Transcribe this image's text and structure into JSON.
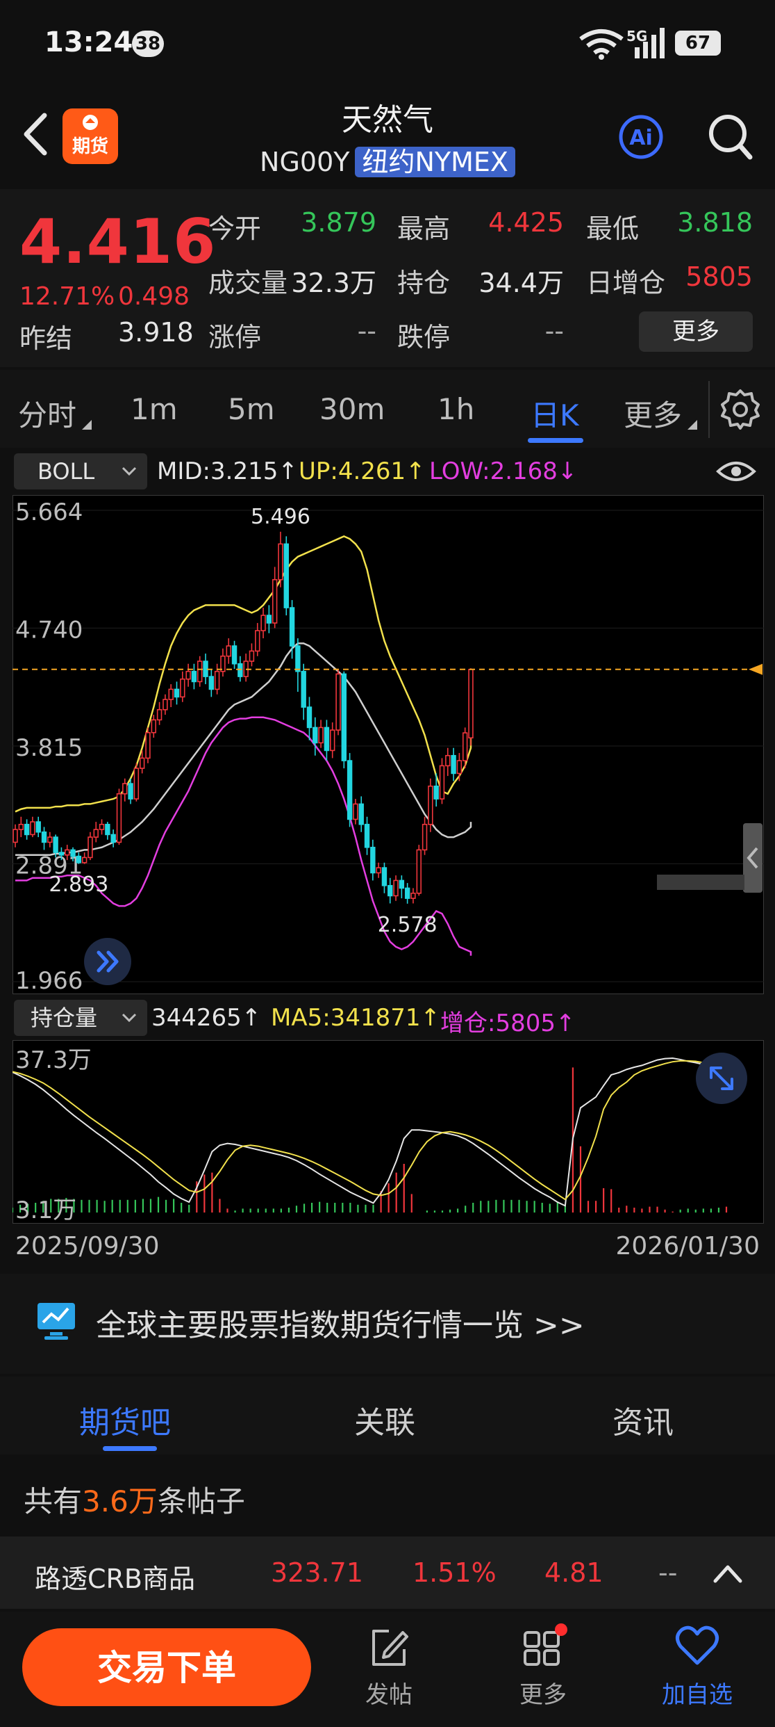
{
  "status_bar": {
    "time": "13:24",
    "notif_count": "38",
    "signal": "5G",
    "battery": "67"
  },
  "header": {
    "title": "天然气",
    "code": "NG00Y",
    "exchange": "纽约NYMEX",
    "logo_text": "期货",
    "ai_label": "Ai"
  },
  "quote": {
    "last": "4.416",
    "change_pct": "12.71%",
    "change": "0.498",
    "prev_label": "昨结",
    "prev": "3.918",
    "rows": [
      [
        {
          "label": "今开",
          "value": "3.879",
          "tone": "green"
        },
        {
          "label": "最高",
          "value": "4.425",
          "tone": "red"
        },
        {
          "label": "最低",
          "value": "3.818",
          "tone": "green"
        }
      ],
      [
        {
          "label": "成交量",
          "value": "32.3万",
          "tone": "white"
        },
        {
          "label": "持仓",
          "value": "34.4万",
          "tone": "white"
        },
        {
          "label": "日增仓",
          "value": "5805",
          "tone": "red"
        }
      ],
      [
        {
          "label": "涨停",
          "value": "--",
          "tone": "muted"
        },
        {
          "label": "跌停",
          "value": "--",
          "tone": "muted"
        }
      ]
    ],
    "more_label": "更多"
  },
  "period_tabs": [
    "分时",
    "1m",
    "5m",
    "30m",
    "1h",
    "日K",
    "更多"
  ],
  "period_active": "日K",
  "boll": {
    "selector": "BOLL",
    "mid": "MID:3.215↑",
    "up": "UP:4.261↑",
    "low": "LOW:2.168↓"
  },
  "position": {
    "selector": "持仓量",
    "value": "344265↑",
    "ma5": "MA5:341871↑",
    "inc": "增仓:5805↑"
  },
  "chart_data": [
    {
      "type": "candlestick",
      "title": "",
      "y_ticks": [
        "5.664",
        "4.740",
        "3.815",
        "2.891",
        "1.966"
      ],
      "ylim": [
        1.966,
        5.664
      ],
      "current_price": 4.416,
      "annotations": [
        {
          "label": "5.496",
          "value": 5.496
        },
        {
          "label": "2.893",
          "value": 2.893
        },
        {
          "label": "2.578",
          "value": 2.578
        }
      ],
      "candles": [
        [
          3.06,
          3.16,
          3.02,
          3.2
        ],
        [
          3.16,
          3.2,
          3.1,
          3.26
        ],
        [
          3.2,
          3.12,
          3.08,
          3.24
        ],
        [
          3.12,
          3.22,
          3.1,
          3.26
        ],
        [
          3.22,
          3.14,
          3.1,
          3.26
        ],
        [
          3.14,
          3.06,
          3.0,
          3.18
        ],
        [
          3.06,
          3.1,
          3.02,
          3.14
        ],
        [
          3.1,
          2.98,
          2.94,
          3.12
        ],
        [
          2.98,
          2.96,
          2.92,
          3.02
        ],
        [
          2.96,
          3.0,
          2.92,
          3.04
        ],
        [
          3.0,
          2.95,
          2.91,
          3.02
        ],
        [
          2.95,
          2.9,
          2.89,
          2.98
        ],
        [
          2.9,
          2.94,
          2.89,
          2.98
        ],
        [
          2.94,
          3.1,
          2.92,
          3.14
        ],
        [
          3.1,
          3.16,
          3.06,
          3.22
        ],
        [
          3.16,
          3.2,
          3.12,
          3.24
        ],
        [
          3.2,
          3.12,
          3.08,
          3.22
        ],
        [
          3.12,
          3.06,
          3.02,
          3.16
        ],
        [
          3.06,
          3.44,
          3.04,
          3.48
        ],
        [
          3.44,
          3.52,
          3.38,
          3.56
        ],
        [
          3.52,
          3.4,
          3.36,
          3.56
        ],
        [
          3.4,
          3.64,
          3.38,
          3.68
        ],
        [
          3.64,
          3.72,
          3.6,
          3.78
        ],
        [
          3.72,
          3.92,
          3.68,
          3.96
        ],
        [
          3.92,
          4.02,
          3.88,
          4.06
        ],
        [
          4.02,
          4.1,
          3.98,
          4.16
        ],
        [
          4.1,
          4.18,
          4.06,
          4.22
        ],
        [
          4.18,
          4.26,
          4.12,
          4.3
        ],
        [
          4.26,
          4.2,
          4.14,
          4.32
        ],
        [
          4.2,
          4.34,
          4.16,
          4.4
        ],
        [
          4.34,
          4.4,
          4.28,
          4.46
        ],
        [
          4.4,
          4.32,
          4.26,
          4.46
        ],
        [
          4.32,
          4.48,
          4.28,
          4.52
        ],
        [
          4.48,
          4.36,
          4.3,
          4.54
        ],
        [
          4.36,
          4.26,
          4.2,
          4.42
        ],
        [
          4.26,
          4.4,
          4.22,
          4.46
        ],
        [
          4.4,
          4.52,
          4.36,
          4.58
        ],
        [
          4.52,
          4.6,
          4.46,
          4.66
        ],
        [
          4.6,
          4.46,
          4.42,
          4.64
        ],
        [
          4.46,
          4.36,
          4.32,
          4.52
        ],
        [
          4.36,
          4.48,
          4.32,
          4.54
        ],
        [
          4.48,
          4.56,
          4.44,
          4.62
        ],
        [
          4.56,
          4.72,
          4.52,
          4.78
        ],
        [
          4.72,
          4.84,
          4.66,
          4.9
        ],
        [
          4.84,
          4.78,
          4.7,
          4.92
        ],
        [
          4.78,
          5.12,
          4.74,
          5.22
        ],
        [
          5.12,
          5.4,
          5.06,
          5.496
        ],
        [
          5.4,
          4.9,
          4.84,
          5.46
        ],
        [
          4.9,
          4.6,
          4.5,
          4.96
        ],
        [
          4.6,
          4.4,
          4.24,
          4.66
        ],
        [
          4.4,
          4.12,
          4.02,
          4.46
        ],
        [
          4.12,
          3.96,
          3.86,
          4.2
        ],
        [
          3.96,
          3.84,
          3.74,
          4.04
        ],
        [
          3.84,
          3.96,
          3.8,
          4.02
        ],
        [
          3.96,
          3.78,
          3.7,
          4.02
        ],
        [
          3.78,
          3.94,
          3.72,
          4.0
        ],
        [
          3.94,
          4.38,
          3.9,
          4.42
        ],
        [
          4.38,
          3.7,
          3.64,
          4.4
        ],
        [
          3.7,
          3.24,
          3.18,
          3.76
        ],
        [
          3.24,
          3.36,
          3.2,
          3.4
        ],
        [
          3.36,
          3.2,
          3.14,
          3.42
        ],
        [
          3.2,
          3.02,
          2.96,
          3.26
        ],
        [
          3.02,
          2.82,
          2.76,
          3.08
        ],
        [
          2.82,
          2.86,
          2.78,
          2.9
        ],
        [
          2.86,
          2.72,
          2.66,
          2.9
        ],
        [
          2.72,
          2.64,
          2.58,
          2.78
        ],
        [
          2.64,
          2.76,
          2.6,
          2.8
        ],
        [
          2.76,
          2.7,
          2.62,
          2.8
        ],
        [
          2.7,
          2.62,
          2.578,
          2.74
        ],
        [
          2.62,
          2.66,
          2.58,
          2.7
        ],
        [
          2.66,
          3.0,
          2.64,
          3.04
        ],
        [
          3.0,
          3.2,
          2.96,
          3.26
        ],
        [
          3.2,
          3.5,
          3.14,
          3.56
        ],
        [
          3.5,
          3.4,
          3.34,
          3.6
        ],
        [
          3.4,
          3.66,
          3.36,
          3.72
        ],
        [
          3.66,
          3.74,
          3.58,
          3.8
        ],
        [
          3.74,
          3.6,
          3.54,
          3.8
        ],
        [
          3.6,
          3.7,
          3.54,
          3.76
        ],
        [
          3.7,
          3.918,
          3.64,
          3.96
        ],
        [
          3.879,
          4.416,
          3.818,
          4.425
        ]
      ],
      "series": [
        {
          "name": "UP",
          "color": "#f2e14c",
          "values": [
            3.3,
            3.32,
            3.33,
            3.33,
            3.33,
            3.33,
            3.33,
            3.34,
            3.34,
            3.35,
            3.35,
            3.35,
            3.36,
            3.36,
            3.37,
            3.38,
            3.39,
            3.4,
            3.42,
            3.48,
            3.56,
            3.66,
            3.8,
            3.96,
            4.12,
            4.3,
            4.46,
            4.6,
            4.7,
            4.78,
            4.84,
            4.88,
            4.9,
            4.92,
            4.92,
            4.92,
            4.92,
            4.92,
            4.92,
            4.9,
            4.88,
            4.86,
            4.88,
            4.92,
            4.98,
            5.04,
            5.12,
            5.2,
            5.26,
            5.3,
            5.32,
            5.34,
            5.36,
            5.38,
            5.4,
            5.42,
            5.44,
            5.46,
            5.44,
            5.4,
            5.34,
            5.2,
            5.0,
            4.8,
            4.64,
            4.52,
            4.42,
            4.32,
            4.22,
            4.12,
            4.02,
            3.9,
            3.74,
            3.58,
            3.46,
            3.44,
            3.52,
            3.58,
            3.66,
            3.8,
            4.1
          ]
        },
        {
          "name": "MID",
          "color": "#cfcfcf",
          "values": [
            2.96,
            2.96,
            2.96,
            2.96,
            2.96,
            2.96,
            2.96,
            2.97,
            2.97,
            2.98,
            2.98,
            2.99,
            3.0,
            3.0,
            3.01,
            3.02,
            3.04,
            3.06,
            3.08,
            3.11,
            3.14,
            3.18,
            3.22,
            3.27,
            3.32,
            3.38,
            3.44,
            3.5,
            3.56,
            3.62,
            3.68,
            3.74,
            3.8,
            3.86,
            3.92,
            3.98,
            4.04,
            4.1,
            4.14,
            4.16,
            4.18,
            4.2,
            4.24,
            4.28,
            4.32,
            4.38,
            4.44,
            4.52,
            4.58,
            4.62,
            4.62,
            4.6,
            4.56,
            4.52,
            4.48,
            4.44,
            4.4,
            4.36,
            4.3,
            4.24,
            4.16,
            4.08,
            4.0,
            3.92,
            3.84,
            3.76,
            3.68,
            3.6,
            3.52,
            3.44,
            3.36,
            3.28,
            3.22,
            3.16,
            3.12,
            3.1,
            3.1,
            3.12,
            3.14,
            3.18,
            3.22
          ]
        },
        {
          "name": "LOW",
          "color": "#e33ee0",
          "values": [
            2.76,
            2.76,
            2.76,
            2.78,
            2.78,
            2.78,
            2.78,
            2.79,
            2.79,
            2.8,
            2.8,
            2.8,
            2.78,
            2.76,
            2.72,
            2.66,
            2.62,
            2.58,
            2.56,
            2.56,
            2.58,
            2.62,
            2.7,
            2.8,
            2.92,
            3.04,
            3.14,
            3.22,
            3.3,
            3.38,
            3.46,
            3.56,
            3.66,
            3.76,
            3.84,
            3.9,
            3.96,
            4.0,
            4.02,
            4.03,
            4.03,
            4.04,
            4.04,
            4.04,
            4.03,
            4.02,
            4.0,
            3.98,
            3.96,
            3.94,
            3.92,
            3.88,
            3.82,
            3.76,
            3.7,
            3.62,
            3.52,
            3.4,
            3.26,
            3.1,
            2.92,
            2.76,
            2.6,
            2.48,
            2.36,
            2.28,
            2.24,
            2.22,
            2.24,
            2.28,
            2.34,
            2.4,
            2.46,
            2.52,
            2.5,
            2.42,
            2.32,
            2.24,
            2.22,
            2.2,
            2.17
          ]
        }
      ]
    },
    {
      "type": "line",
      "title": "",
      "y_ticks": [
        "37.3万",
        "3.1万"
      ],
      "ylim": [
        3.1,
        37.3
      ],
      "x_range_labels": [
        "2025/09/30",
        "2026/01/30"
      ],
      "series": [
        {
          "name": "持仓量",
          "color": "#e6e6e6",
          "values": [
            34.2,
            33.4,
            32.5,
            31.5,
            30.3,
            28.9,
            27.5,
            26.0,
            24.6,
            23.3,
            22.0,
            20.7,
            19.5,
            18.2,
            16.9,
            15.6,
            14.3,
            12.9,
            11.5,
            9.9,
            8.6,
            7.2,
            6.2,
            5.4,
            8.6,
            12.5,
            16.6,
            18.0,
            18.4,
            18.2,
            17.8,
            17.4,
            17.0,
            16.6,
            16.2,
            15.8,
            15.3,
            14.6,
            13.7,
            12.7,
            11.6,
            10.6,
            9.6,
            8.6,
            7.6,
            6.8,
            6.0,
            5.2,
            7.4,
            10.4,
            14.5,
            19.5,
            21.4,
            21.4,
            21.2,
            21.0,
            20.8,
            20.5,
            20.1,
            19.4,
            18.4,
            17.2,
            16.0,
            14.7,
            13.4,
            12.1,
            10.8,
            9.6,
            8.4,
            7.4,
            6.5,
            5.4,
            4.6,
            19.5,
            26.3,
            27.5,
            28.7,
            31.2,
            33.6,
            34.1,
            34.8,
            35.3,
            35.7,
            36.3,
            36.9,
            37.2,
            37.3,
            37.0,
            36.6,
            36.3,
            35.9,
            35.5,
            35.0,
            34.4
          ]
        },
        {
          "name": "MA5",
          "color": "#f2e14c",
          "values": [
            34.3,
            33.9,
            33.3,
            32.6,
            31.8,
            30.7,
            29.5,
            28.2,
            26.9,
            25.6,
            24.3,
            23.1,
            21.9,
            20.7,
            19.5,
            18.3,
            17.1,
            15.9,
            14.6,
            13.2,
            11.8,
            10.4,
            9.2,
            8.0,
            7.6,
            8.3,
            9.9,
            12.2,
            14.8,
            16.9,
            17.8,
            18.0,
            17.8,
            17.4,
            17.0,
            16.6,
            16.2,
            15.7,
            15.1,
            14.4,
            13.6,
            12.7,
            11.8,
            10.9,
            10.0,
            9.0,
            8.0,
            7.2,
            6.9,
            7.3,
            8.6,
            10.8,
            13.6,
            16.6,
            18.8,
            20.1,
            20.8,
            21.0,
            20.7,
            20.3,
            19.7,
            18.9,
            18.0,
            16.9,
            15.7,
            14.4,
            13.1,
            11.8,
            10.5,
            9.3,
            8.2,
            7.1,
            6.0,
            8.0,
            11.2,
            15.3,
            20.0,
            26.0,
            29.1,
            30.8,
            32.0,
            33.6,
            34.5,
            35.1,
            35.6,
            36.1,
            36.5,
            36.7,
            36.7,
            36.6,
            36.3,
            35.9,
            35.5,
            35.1
          ]
        },
        {
          "name": "增仓",
          "color": "#35c65a",
          "values": [
            -0.5,
            -0.8,
            -0.9,
            -1.0,
            -1.2,
            -1.4,
            -1.4,
            -1.5,
            -1.4,
            -1.3,
            -1.3,
            -1.3,
            -1.2,
            -1.3,
            -1.3,
            -1.3,
            -1.3,
            -1.4,
            -1.4,
            -1.6,
            -1.3,
            -1.4,
            -1.0,
            -0.8,
            3.2,
            3.9,
            4.1,
            1.4,
            0.4,
            -0.2,
            -0.4,
            -0.4,
            -0.4,
            -0.4,
            -0.4,
            -0.4,
            -0.5,
            -0.7,
            -0.9,
            -1.0,
            -1.1,
            -1.0,
            -1.0,
            -1.0,
            -1.0,
            -0.8,
            -0.8,
            -0.8,
            2.2,
            3.0,
            4.1,
            5.0,
            1.9,
            0,
            -0.2,
            -0.2,
            -0.2,
            -0.3,
            -0.4,
            -0.7,
            -1.0,
            -1.2,
            -1.2,
            -1.3,
            -1.3,
            -1.3,
            -1.3,
            -1.2,
            -1.2,
            -1.0,
            -0.9,
            -1.1,
            -0.8,
            14.9,
            6.8,
            1.2,
            1.2,
            2.5,
            2.4,
            0.5,
            0.7,
            0.5,
            0.4,
            0.6,
            0.6,
            0.3,
            0.1,
            -0.3,
            -0.4,
            -0.3,
            -0.4,
            -0.4,
            -0.5,
            0.6
          ]
        }
      ]
    }
  ],
  "banner": {
    "text": "全球主要股票指数期货行情一览 >>"
  },
  "community_tabs": [
    "期货吧",
    "关联",
    "资讯"
  ],
  "community_active": "期货吧",
  "posts": {
    "prefix": "共有",
    "count": "3.6万",
    "suffix": "条帖子"
  },
  "ticker": {
    "name": "路透CRB商品",
    "price": "323.71",
    "pct": "1.51%",
    "change": "4.81",
    "extra": "--"
  },
  "bottom_nav": {
    "trade": "交易下单",
    "post": "发帖",
    "more": "更多",
    "watch": "加自选"
  },
  "colors": {
    "up": "#f0363c",
    "down": "#35c65a",
    "accent": "#3d79ff",
    "brand": "#ff5014"
  }
}
